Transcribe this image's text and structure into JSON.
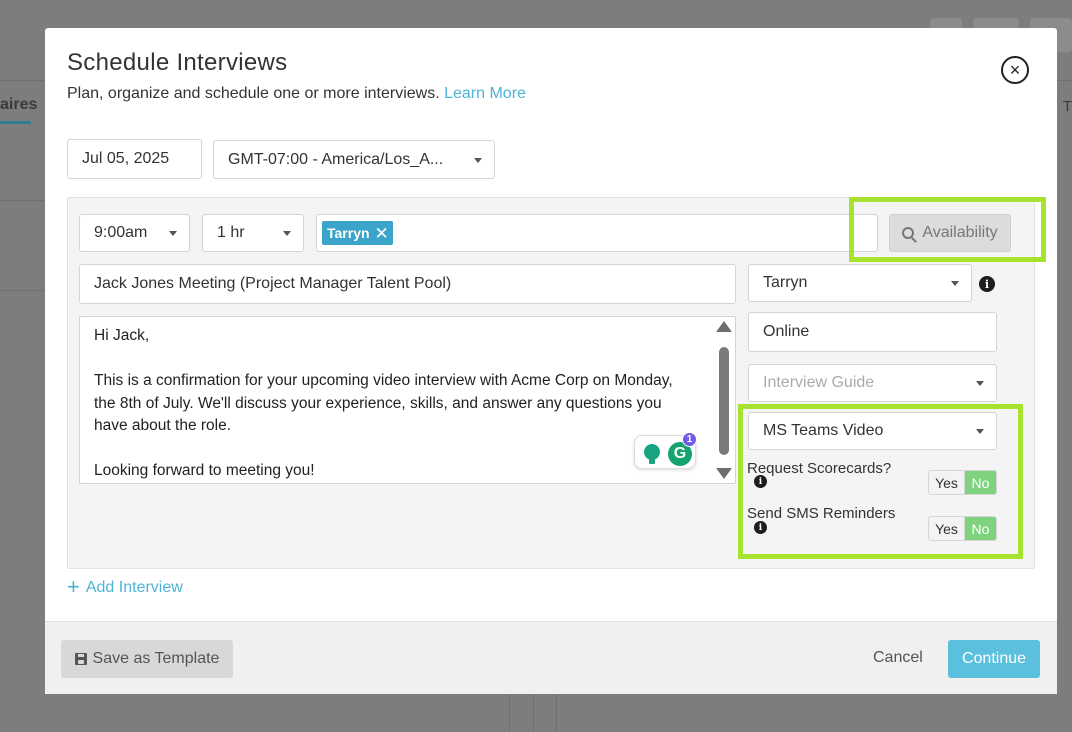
{
  "background": {
    "tab_fragment": "aires",
    "right_fragment": "T"
  },
  "modal": {
    "title": "Schedule Interviews",
    "subtitle": "Plan, organize and schedule one or more interviews.",
    "learn_more": "Learn More",
    "close_symbol": "×"
  },
  "date_row": {
    "date": "Jul 05, 2025",
    "timezone": "GMT-07:00 - America/Los_A..."
  },
  "interview": {
    "start_time": "9:00am",
    "duration": "1 hr",
    "attendees": [
      {
        "label": "Tarryn",
        "remove_symbol": "✕"
      }
    ],
    "availability_label": "Availability",
    "meeting_title": "Jack Jones Meeting (Project Manager Talent Pool)",
    "organizer": "Tarryn",
    "message": "Hi Jack,\n\nThis is a confirmation for your upcoming video interview with Acme Corp on Monday, the 8th of July. We'll discuss your experience, skills, and answer any questions you have about the role.\n\nLooking forward to meeting you!",
    "location": "Online",
    "interview_guide_placeholder": "Interview Guide",
    "video_type": "MS Teams Video",
    "grammarly_badge": "1",
    "grammarly_letter": "G",
    "toggles": [
      {
        "label": "Request Scorecards?",
        "yes": "Yes",
        "no": "No",
        "selected": "No"
      },
      {
        "label": "Send SMS Reminders",
        "yes": "Yes",
        "no": "No",
        "selected": "No"
      }
    ],
    "info_symbol": "i"
  },
  "add_interview": {
    "plus": "+",
    "label": "Add Interview"
  },
  "footer": {
    "save_template": "Save as Template",
    "cancel": "Cancel",
    "continue": "Continue"
  },
  "colors": {
    "accent": "#4eb3d7",
    "highlight": "#a6e22e",
    "toggle_on": "#7fd37f",
    "continue": "#5bc0de"
  }
}
